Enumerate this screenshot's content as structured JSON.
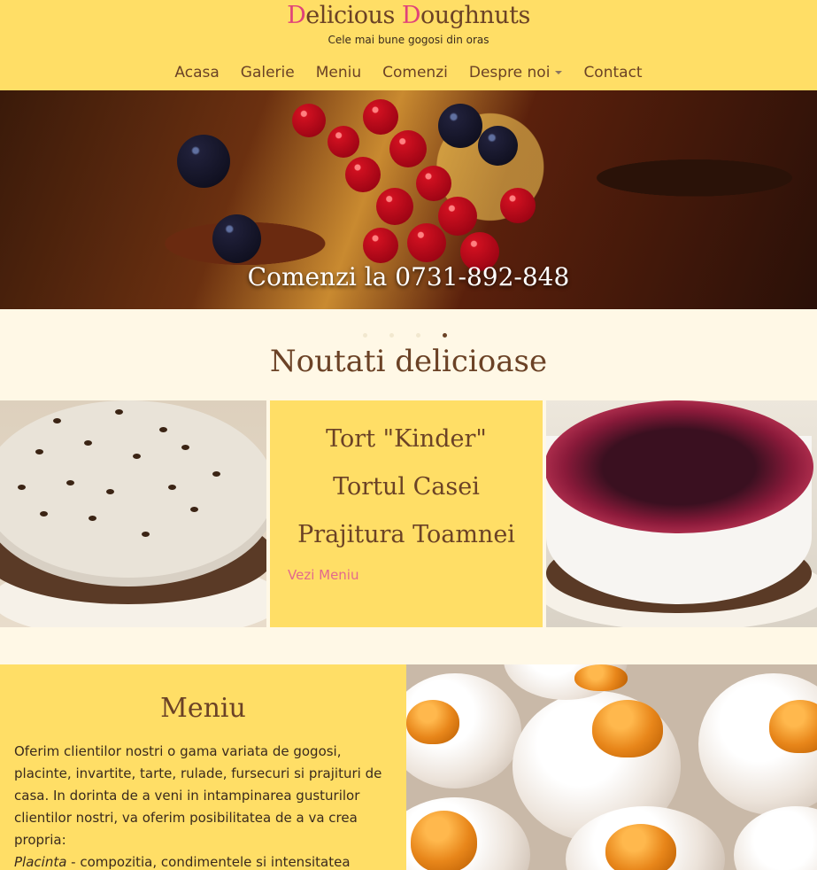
{
  "header": {
    "logo_cap1": "D",
    "logo_rest1": "elicious ",
    "logo_cap2": "D",
    "logo_rest2": "oughnuts",
    "tagline": "Cele mai bune gogosi din oras",
    "nav": [
      {
        "label": "Acasa"
      },
      {
        "label": "Galerie"
      },
      {
        "label": "Meniu"
      },
      {
        "label": "Comenzi"
      },
      {
        "label": "Despre noi",
        "has_dropdown": true
      },
      {
        "label": "Contact"
      }
    ]
  },
  "hero": {
    "caption": "Comenzi la 0731-892-848",
    "slides_total": 4,
    "active_slide": 4
  },
  "noutati": {
    "title": "Noutati delicioase",
    "items": [
      "Tort \"Kinder\"",
      "Tortul Casei",
      "Prajitura Toamnei"
    ],
    "link": "Vezi Meniu"
  },
  "meniu": {
    "title": "Meniu",
    "text_main": "Oferim clientilor nostri o gama variata de gogosi, placinte, invartite, tarte, rulade, fursecuri si prajituri de casa. In dorinta de a veni in intampinarea gusturilor clientilor nostri, va oferim posibilitatea de a va crea propria:",
    "text_em": "Placinta",
    "text_tail": " - compozitia, condimentele si intensitatea acestora, la cererea clientilor."
  },
  "colors": {
    "header_bg": "#ffde66",
    "page_bg": "#fff8e6",
    "brown": "#6b4226",
    "pink_accent": "#e36a8c"
  }
}
